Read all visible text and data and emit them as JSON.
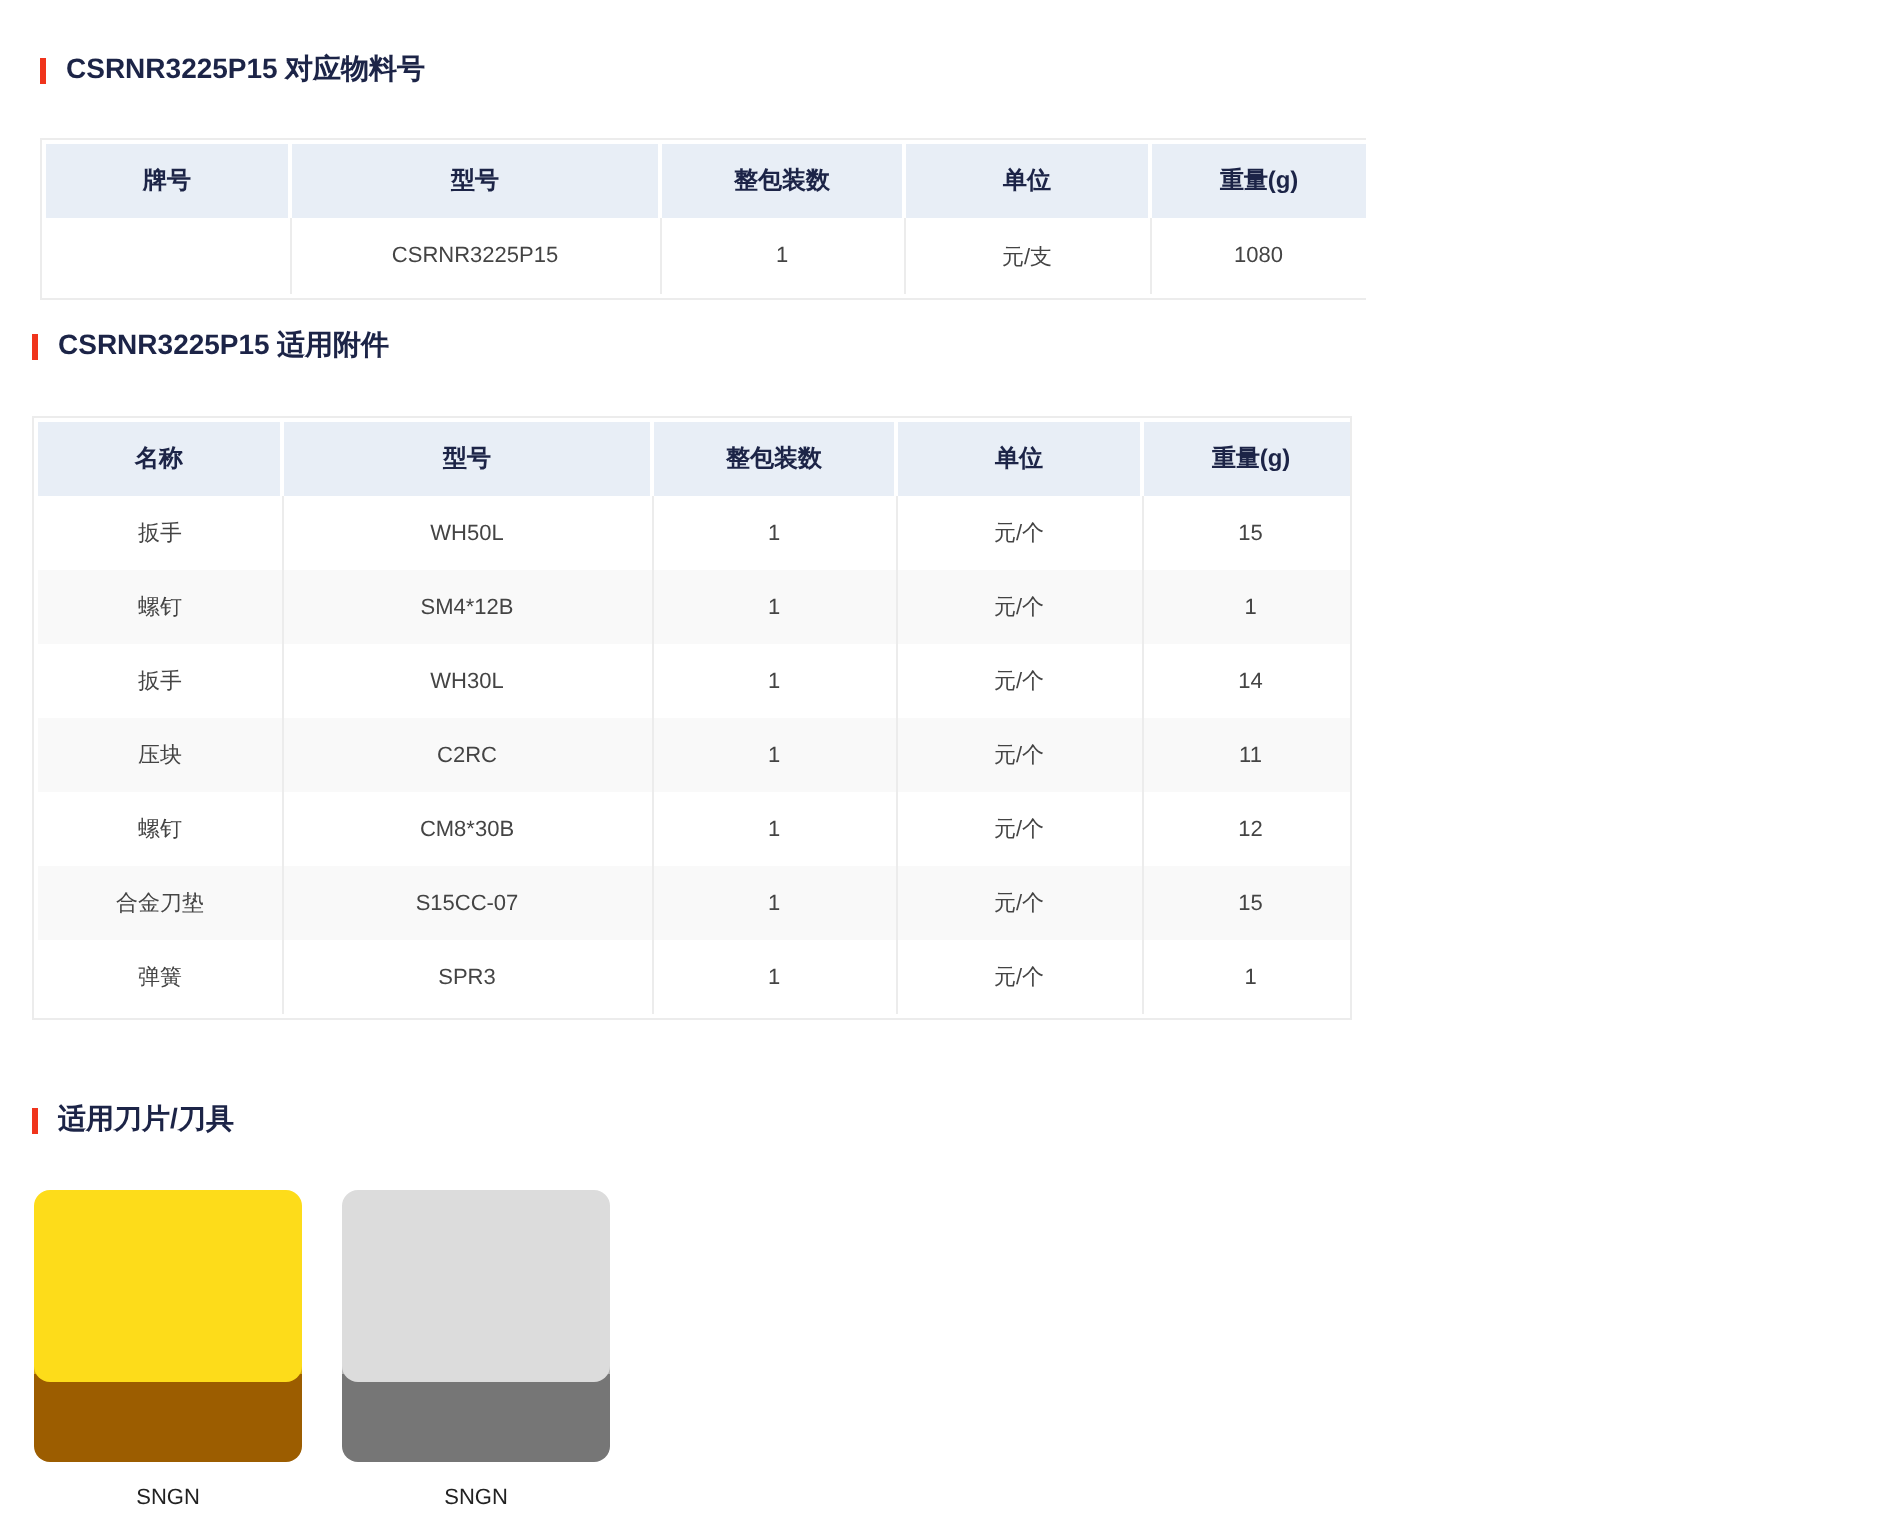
{
  "sections": [
    {
      "kind": "table",
      "title": "CSRNR3225P15  对应物料号",
      "columns": [
        "牌号",
        "型号",
        "整包装数",
        "单位",
        "重量(g)"
      ],
      "rows": [
        [
          "",
          "CSRNR3225P15",
          "1",
          "元/支",
          "1080"
        ]
      ]
    },
    {
      "kind": "table",
      "title": "CSRNR3225P15  适用附件",
      "columns": [
        "名称",
        "型号",
        "整包装数",
        "单位",
        "重量(g)"
      ],
      "rows": [
        [
          "扳手",
          "WH50L",
          "1",
          "元/个",
          "15"
        ],
        [
          "螺钉",
          "SM4*12B",
          "1",
          "元/个",
          "1"
        ],
        [
          "扳手",
          "WH30L",
          "1",
          "元/个",
          "14"
        ],
        [
          "压块",
          "C2RC",
          "1",
          "元/个",
          "11"
        ],
        [
          "螺钉",
          "CM8*30B",
          "1",
          "元/个",
          "12"
        ],
        [
          "合金刀垫",
          "S15CC-07",
          "1",
          "元/个",
          "15"
        ],
        [
          "弹簧",
          "SPR3",
          "1",
          "元/个",
          "1"
        ]
      ]
    },
    {
      "kind": "gallery",
      "title": "适用刀片/刀具",
      "items": [
        {
          "kind": "picture",
          "caption": "SNGN"
        },
        {
          "kind": "picture",
          "caption": "SNGN"
        }
      ]
    }
  ]
}
